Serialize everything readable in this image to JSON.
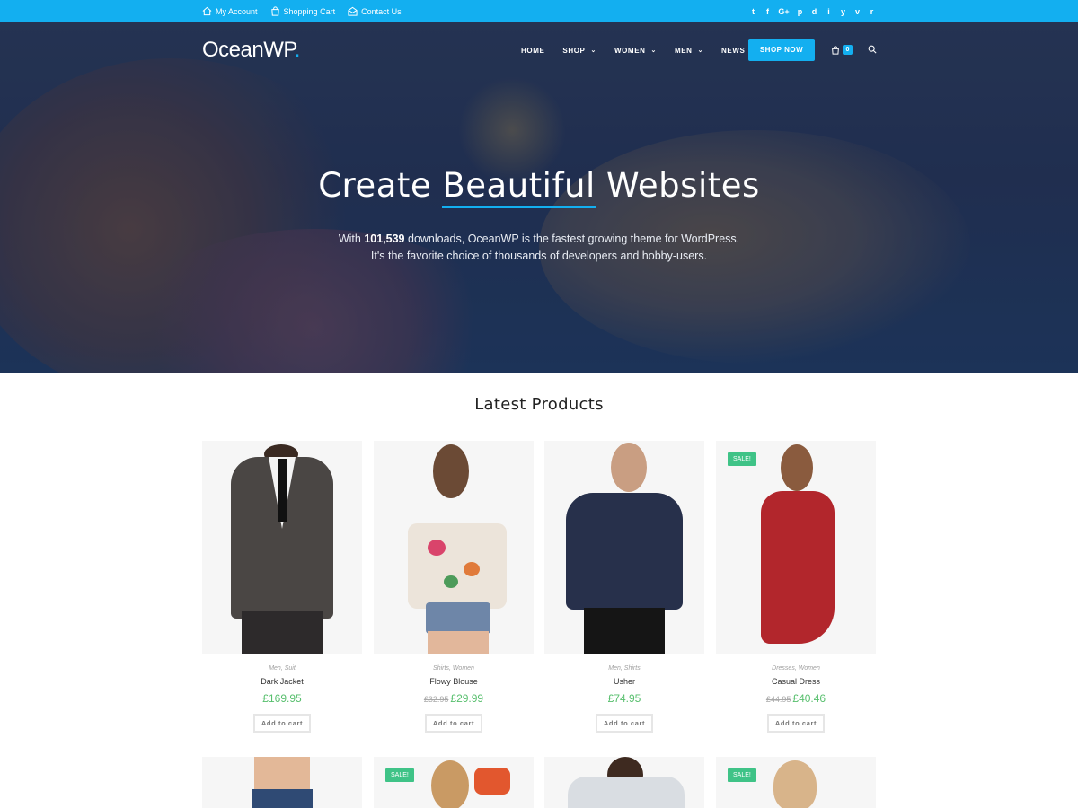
{
  "topbar": {
    "links": [
      {
        "label": "My Account",
        "icon": "home-icon"
      },
      {
        "label": "Shopping Cart",
        "icon": "bag-icon"
      },
      {
        "label": "Contact Us",
        "icon": "envelope-icon"
      }
    ],
    "social": [
      {
        "glyph": "t",
        "icon": "twitter-icon"
      },
      {
        "glyph": "f",
        "icon": "facebook-icon"
      },
      {
        "glyph": "G+",
        "icon": "google-plus-icon"
      },
      {
        "glyph": "p",
        "icon": "pinterest-icon"
      },
      {
        "glyph": "d",
        "icon": "dribbble-icon"
      },
      {
        "glyph": "i",
        "icon": "instagram-icon"
      },
      {
        "glyph": "y",
        "icon": "youtube-icon"
      },
      {
        "glyph": "v",
        "icon": "vimeo-icon"
      },
      {
        "glyph": "r",
        "icon": "rss-icon"
      }
    ]
  },
  "header": {
    "logo_text": "OceanWP",
    "logo_dot": ".",
    "nav": [
      {
        "label": "HOME",
        "dropdown": false
      },
      {
        "label": "SHOP",
        "dropdown": true
      },
      {
        "label": "WOMEN",
        "dropdown": true
      },
      {
        "label": "MEN",
        "dropdown": true
      },
      {
        "label": "NEWS",
        "dropdown": false
      }
    ],
    "shop_now": "SHOP NOW",
    "cart_count": "0"
  },
  "hero": {
    "title_pre": "Create ",
    "title_underlined": "Beautiful",
    "title_post": " Websites",
    "sub_line1_pre": "With ",
    "sub_line1_bold": "101,539",
    "sub_line1_post": " downloads, OceanWP is the fastest growing theme for WordPress.",
    "sub_line2": "It's the favorite choice of thousands of developers and hobby-users."
  },
  "products_section": {
    "title": "Latest Products",
    "add_to_cart": "Add to cart",
    "sale_label": "SALE!",
    "products": [
      {
        "categories": "Men, Suit",
        "name": "Dark Jacket",
        "old_price": "",
        "price": "£169.95",
        "sale": false
      },
      {
        "categories": "Shirts, Women",
        "name": "Flowy Blouse",
        "old_price": "£32.95",
        "price": "£29.99",
        "sale": false
      },
      {
        "categories": "Men, Shirts",
        "name": "Usher",
        "old_price": "",
        "price": "£74.95",
        "sale": false
      },
      {
        "categories": "Dresses, Women",
        "name": "Casual Dress",
        "old_price": "£44.95",
        "price": "£40.46",
        "sale": true
      }
    ],
    "second_row_sale": [
      false,
      true,
      false,
      true
    ]
  },
  "colors": {
    "accent": "#13aff0",
    "price_green": "#57bf6d",
    "sale_green": "#3fc387"
  }
}
